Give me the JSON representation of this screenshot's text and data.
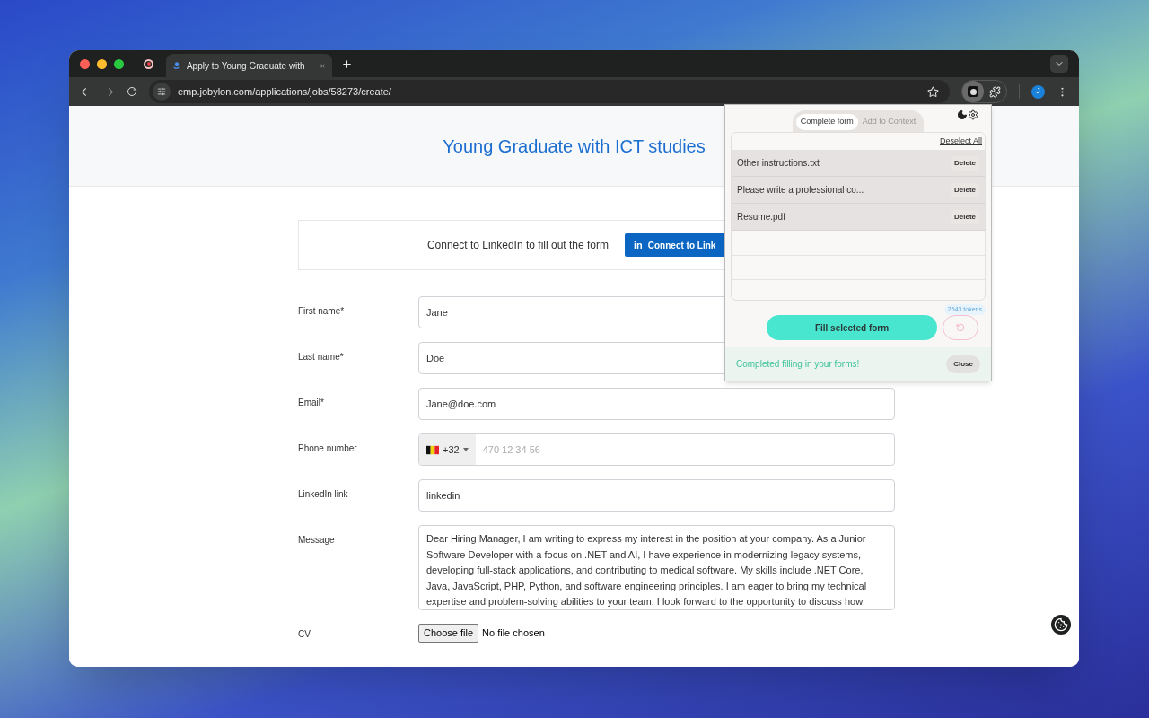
{
  "browser": {
    "tabs": [
      {
        "title": "Apply to Young Graduate with",
        "selected": true
      }
    ],
    "address": "emp.jobylon.com/applications/jobs/58273/create/",
    "profile_initial": "J"
  },
  "page": {
    "title": "Young Graduate with ICT studies",
    "linkedin_prompt": "Connect to LinkedIn to fill out the form",
    "linkedin_logo": "in",
    "linkedin_button": "Connect to Link",
    "fields": [
      {
        "kind": "text",
        "label": "First name*",
        "value": "Jane"
      },
      {
        "kind": "text",
        "label": "Last name*",
        "value": "Doe"
      },
      {
        "kind": "text",
        "label": "Email*",
        "value": "Jane@doe.com"
      },
      {
        "kind": "phone",
        "label": "Phone number",
        "country_code": "+32",
        "placeholder": "470 12 34 56"
      },
      {
        "kind": "text",
        "label": "LinkedIn link",
        "value": "linkedin"
      },
      {
        "kind": "textarea",
        "label": "Message",
        "value": "Dear Hiring Manager, I am writing to express my interest in the position at your company. As a Junior Software Developer with a focus on .NET and AI, I have experience in modernizing legacy systems, developing full-stack applications, and contributing to medical software. My skills include .NET Core, Java, JavaScript, PHP, Python, and software engineering principles. I am eager to bring my technical expertise and problem-solving abilities to your team. I look forward to the opportunity to discuss how"
      },
      {
        "kind": "file",
        "label": "CV",
        "button": "Choose file",
        "status": "No file chosen"
      }
    ]
  },
  "extension": {
    "tabs": [
      {
        "label": "Complete form",
        "selected": true
      },
      {
        "label": "Add to Context",
        "selected": false
      }
    ],
    "deselect_all": "Deselect All",
    "files": [
      {
        "name": "Other instructions.txt",
        "action": "Delete"
      },
      {
        "name": "Please write a professional co...",
        "action": "Delete"
      },
      {
        "name": "Resume.pdf",
        "action": "Delete"
      }
    ],
    "tokens": "2543 tokens",
    "fill_button": "Fill selected form",
    "status": "Completed filling in your forms!",
    "close": "Close"
  }
}
